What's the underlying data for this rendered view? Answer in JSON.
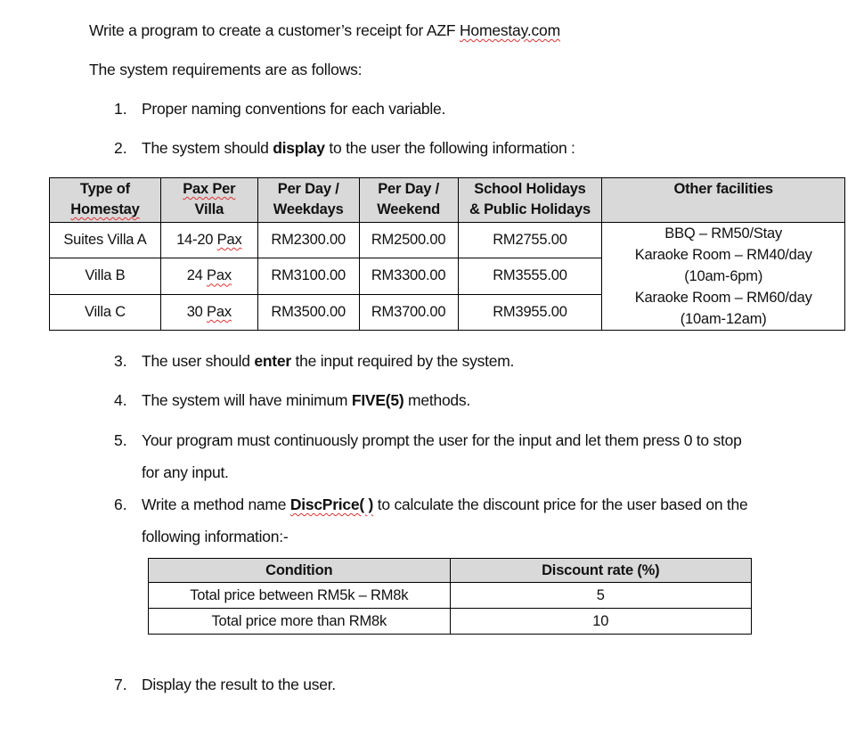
{
  "intro": {
    "line1_prefix": "Write a program to create a customer’s receipt for AZF ",
    "line1_site": "Homestay.com",
    "line2": "The system requirements are as follows:"
  },
  "requirements": [
    {
      "num": "1.",
      "text": "Proper naming conventions for each variable."
    },
    {
      "num": "2.",
      "pre": "The system should ",
      "bold": "display",
      "post": " to the user the following information :"
    },
    {
      "num": "3.",
      "pre": "The user should ",
      "bold": "enter",
      "post": " the input required by the system."
    },
    {
      "num": "4.",
      "pre": "The system will have minimum ",
      "bold": "FIVE(5)",
      "post": " methods."
    },
    {
      "num": "5.",
      "line1": "Your program must continuously prompt the user for the input and let them press 0 to stop",
      "line2": "for any input."
    },
    {
      "num": "6.",
      "pre": "Write a method name ",
      "bold": "DiscPrice( )",
      "post": " to calculate the discount price for the user based on the",
      "line2": "following information:-"
    },
    {
      "num": "7.",
      "text": "Display the result to the user."
    }
  ],
  "price_table": {
    "headers": [
      [
        "Type of",
        "Homestay"
      ],
      [
        "Pax Per",
        "Villa"
      ],
      [
        "Per Day /",
        "Weekdays"
      ],
      [
        "Per Day /",
        "Weekend"
      ],
      [
        "School Holidays",
        "& Public Holidays"
      ],
      [
        "Other facilities",
        ""
      ]
    ],
    "rows": [
      {
        "type": "Suites Villa A",
        "pax_num": "14-20 ",
        "pax_unit": "Pax",
        "weekday": "RM2300.00",
        "weekend": "RM2500.00",
        "holiday": "RM2755.00"
      },
      {
        "type": "Villa B",
        "pax_num": "24 ",
        "pax_unit": "Pax",
        "weekday": "RM3100.00",
        "weekend": "RM3300.00",
        "holiday": "RM3555.00"
      },
      {
        "type": "Villa C",
        "pax_num": "30 ",
        "pax_unit": "Pax",
        "weekday": "RM3500.00",
        "weekend": "RM3700.00",
        "holiday": "RM3955.00"
      }
    ],
    "facilities": [
      "BBQ – RM50/Stay",
      "Karaoke Room – RM40/day",
      "(10am-6pm)",
      "Karaoke Room – RM60/day",
      "(10am-12am)"
    ]
  },
  "discount_table": {
    "headers": [
      "Condition",
      "Discount rate (%)"
    ],
    "rows": [
      {
        "condition": "Total price between RM5k – RM8k",
        "rate": "5"
      },
      {
        "condition": "Total price more than RM8k",
        "rate": "10"
      }
    ]
  },
  "colors": {
    "header_bg": "#d9d9d9",
    "border": "#000000",
    "spellcheck": "#dd3333"
  }
}
